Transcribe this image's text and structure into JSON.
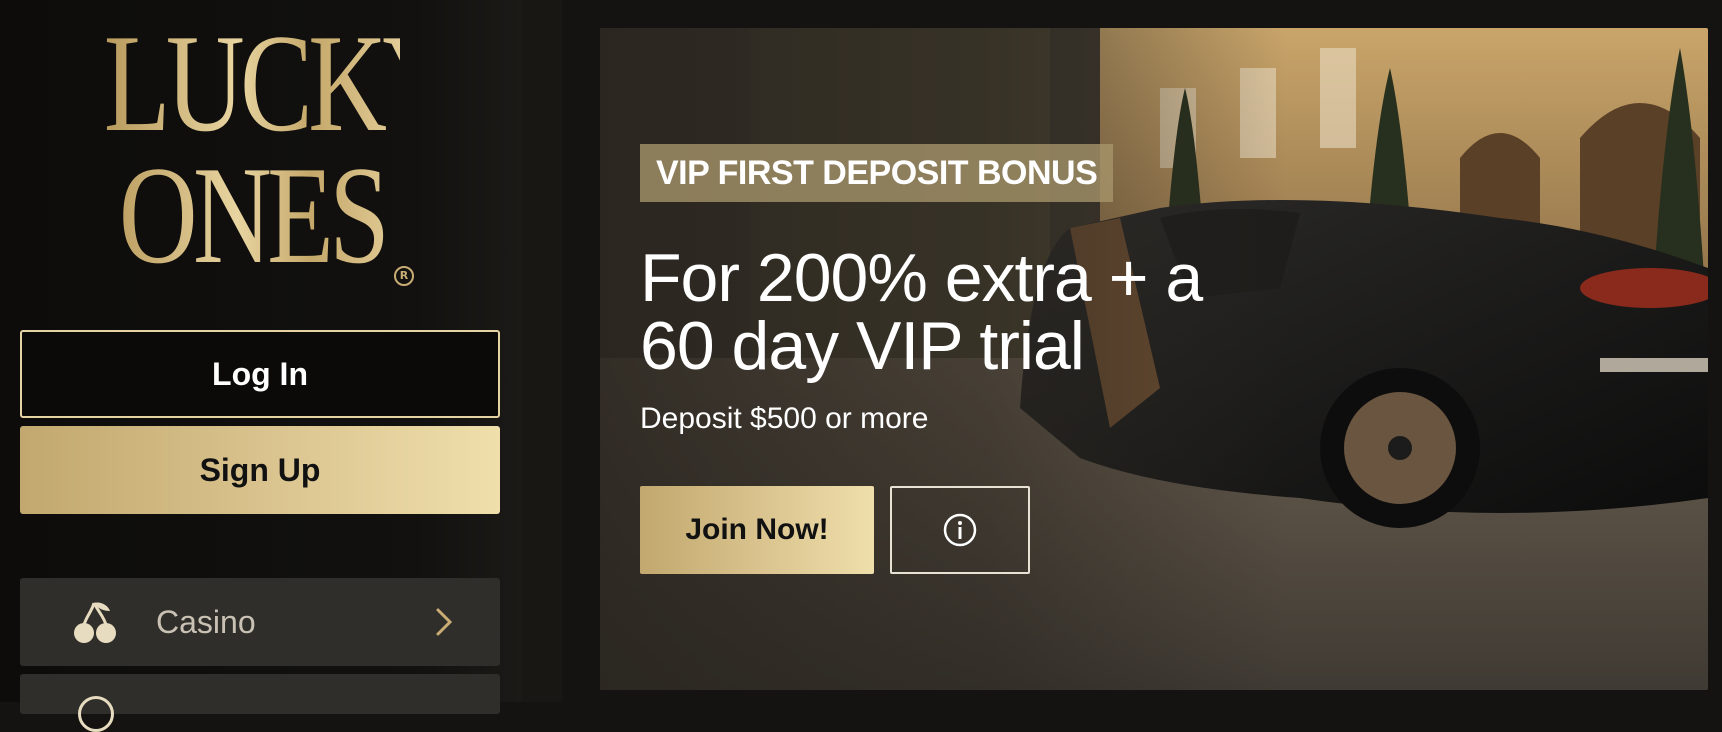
{
  "brand": {
    "line1": "LUCKY",
    "line2": "ONES",
    "registered": "R"
  },
  "auth": {
    "login_label": "Log In",
    "signup_label": "Sign Up"
  },
  "nav": {
    "items": [
      {
        "label": "Casino",
        "icon": "cherry-icon"
      }
    ]
  },
  "hero": {
    "badge": "VIP FIRST DEPOSIT BONUS",
    "headline": "For 200% extra + a 60 day VIP trial",
    "subline": "Deposit $500 or more",
    "join_label": "Join Now!",
    "info_icon": "info-icon"
  },
  "colors": {
    "gold_start": "#c2a86e",
    "gold_end": "#efdfab",
    "background": "#141311",
    "nav_item_bg": "#302e2a"
  }
}
